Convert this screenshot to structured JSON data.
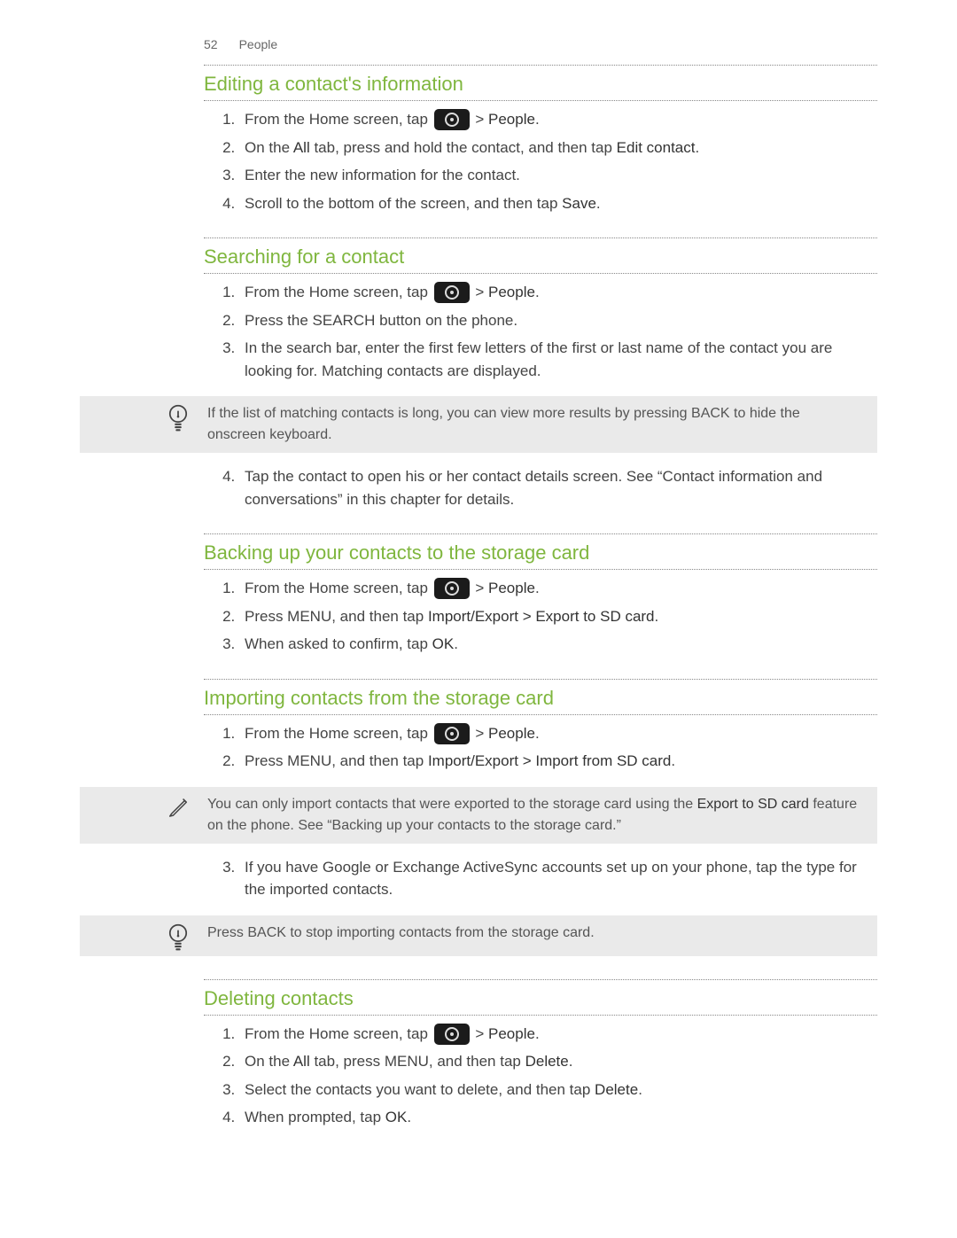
{
  "header": {
    "page_number": "52",
    "chapter": "People"
  },
  "s1": {
    "title": "Editing a contact's information",
    "steps": {
      "a_pre": "From the Home screen, tap ",
      "a_post": " > ",
      "a_bold": "People",
      "a_end": ".",
      "b_pre": "On the ",
      "b_bold1": "All",
      "b_mid": " tab, press and hold the contact, and then tap ",
      "b_bold2": "Edit contact",
      "b_end": ".",
      "c": "Enter the new information for the contact.",
      "d_pre": "Scroll to the bottom of the screen, and then tap ",
      "d_bold": "Save",
      "d_end": "."
    }
  },
  "s2": {
    "title": "Searching for a contact",
    "steps": {
      "a_pre": "From the Home screen, tap ",
      "a_post": " > ",
      "a_bold": "People",
      "a_end": ".",
      "b": "Press the SEARCH button on the phone.",
      "c": "In the search bar, enter the first few letters of the first or last name of the contact you are looking for. Matching contacts are displayed.",
      "d": "Tap the contact to open his or her contact details screen. See “Contact information and conversations” in this chapter for details."
    },
    "tip": "If the list of matching contacts is long, you can view more results by pressing BACK to hide the onscreen keyboard."
  },
  "s3": {
    "title": "Backing up your contacts to the storage card",
    "steps": {
      "a_pre": "From the Home screen, tap ",
      "a_post": " > ",
      "a_bold": "People",
      "a_end": ".",
      "b_pre": "Press MENU, and then tap ",
      "b_bold": "Import/Export > Export to SD card",
      "b_end": ".",
      "c_pre": "When asked to confirm, tap ",
      "c_bold": "OK",
      "c_end": "."
    }
  },
  "s4": {
    "title": "Importing contacts from the storage card",
    "steps": {
      "a_pre": "From the Home screen, tap ",
      "a_post": " > ",
      "a_bold": "People",
      "a_end": ".",
      "b_pre": "Press MENU, and then tap ",
      "b_bold": "Import/Export > Import from SD card",
      "b_end": ".",
      "c": "If you have Google or Exchange ActiveSync accounts set up on your phone, tap the type for the imported contacts."
    },
    "note_pre": "You can only import contacts that were exported to the storage card using the ",
    "note_bold": "Export to SD card",
    "note_post": " feature on the phone. See “Backing up your contacts to the storage card.”",
    "tip": "Press BACK to stop importing contacts from the storage card."
  },
  "s5": {
    "title": "Deleting contacts",
    "steps": {
      "a_pre": "From the Home screen, tap ",
      "a_post": " > ",
      "a_bold": "People",
      "a_end": ".",
      "b_pre": "On the ",
      "b_bold1": "All",
      "b_mid": " tab, press MENU, and then tap ",
      "b_bold2": "Delete",
      "b_end": ".",
      "c_pre": "Select the contacts you want to delete, and then tap ",
      "c_bold": "Delete",
      "c_end": ".",
      "d_pre": "When prompted, tap ",
      "d_bold": "OK",
      "d_end": "."
    }
  }
}
